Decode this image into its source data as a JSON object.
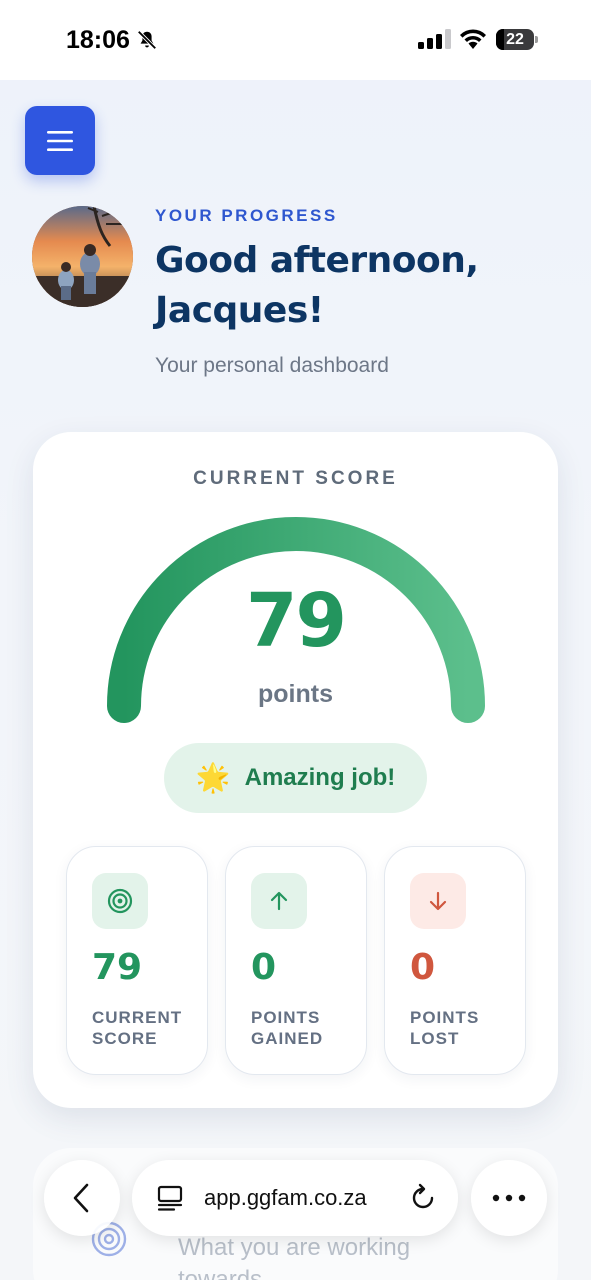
{
  "status_bar": {
    "time": "18:06",
    "battery": "22",
    "battery_level": 0.22,
    "icons": [
      "bell-off-icon",
      "signal-icon",
      "wifi-icon",
      "battery-icon"
    ]
  },
  "header": {
    "menu_icon": "hamburger-icon",
    "eyebrow": "YOUR PROGRESS",
    "greeting_line1": "Good afternoon,",
    "greeting_line2": "Jacques!",
    "subtitle": "Your personal dashboard"
  },
  "score_card": {
    "label": "CURRENT SCORE",
    "value": "79",
    "unit": "points",
    "gauge_fraction": 1.0,
    "badge_emoji": "🌟",
    "badge_text": "Amazing job!",
    "accent_color": "#23955e"
  },
  "stats": [
    {
      "icon": "target-icon",
      "value": "79",
      "label_line1": "CURRENT",
      "label_line2": "SCORE",
      "color": "#23955e",
      "icon_bg": "#e3f3ea"
    },
    {
      "icon": "arrow-up-icon",
      "value": "0",
      "label_line1": "POINTS",
      "label_line2": "GAINED",
      "color": "#23955e",
      "icon_bg": "#e3f3ea"
    },
    {
      "icon": "arrow-down-icon",
      "value": "0",
      "label_line1": "POINTS",
      "label_line2": "LOST",
      "color": "#d0573e",
      "icon_bg": "#fdeae6"
    }
  ],
  "next_card": {
    "icon": "target-icon",
    "text": "What you are working towards"
  },
  "browser": {
    "back_icon": "chevron-left-icon",
    "tabs_icon": "tab-icon",
    "url": "app.ggfam.co.za",
    "reload_icon": "reload-icon",
    "more_icon": "more-icon"
  }
}
